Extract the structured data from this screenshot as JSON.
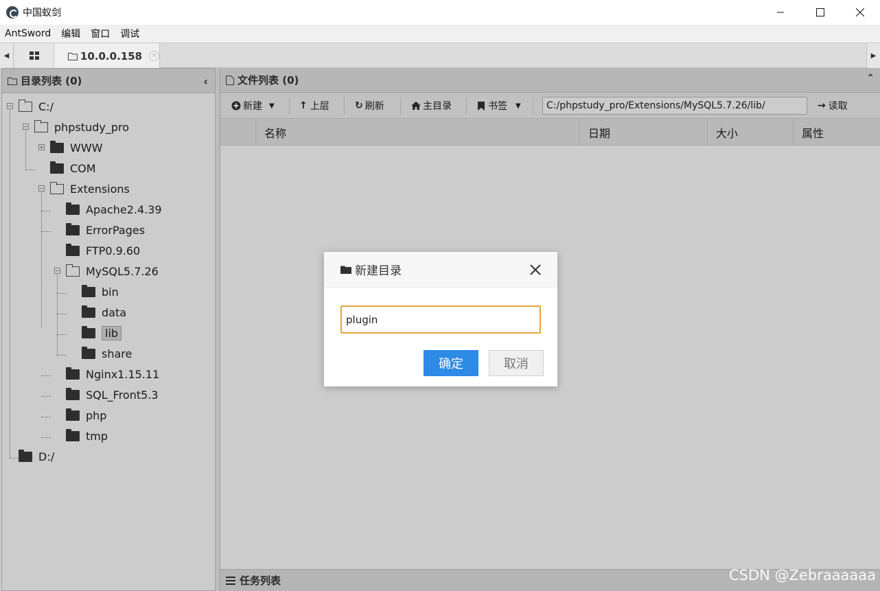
{
  "window": {
    "title": "中国蚁剑",
    "minimize_icon": "minimize-icon",
    "maximize_icon": "maximize-icon",
    "close_icon": "close-icon"
  },
  "menu": [
    "AntSword",
    "编辑",
    "窗口",
    "调试"
  ],
  "tabs": {
    "active_label": "10.0.0.158"
  },
  "left_panel": {
    "title": "目录列表 (0)"
  },
  "tree": [
    {
      "label": "C:/",
      "type": "open"
    },
    {
      "label": "phpstudy_pro",
      "type": "open"
    },
    {
      "label": "WWW",
      "type": "closed"
    },
    {
      "label": "COM",
      "type": "closed"
    },
    {
      "label": "Extensions",
      "type": "open"
    },
    {
      "label": "Apache2.4.39",
      "type": "closed"
    },
    {
      "label": "ErrorPages",
      "type": "closed"
    },
    {
      "label": "FTP0.9.60",
      "type": "closed"
    },
    {
      "label": "MySQL5.7.26",
      "type": "open"
    },
    {
      "label": "bin",
      "type": "closed"
    },
    {
      "label": "data",
      "type": "closed"
    },
    {
      "label": "lib",
      "type": "closed",
      "selected": true
    },
    {
      "label": "share",
      "type": "closed"
    },
    {
      "label": "Nginx1.15.11",
      "type": "closed"
    },
    {
      "label": "SQL_Front5.3",
      "type": "closed"
    },
    {
      "label": "php",
      "type": "closed"
    },
    {
      "label": "tmp",
      "type": "closed"
    },
    {
      "label": "D:/",
      "type": "closed"
    }
  ],
  "right_panel": {
    "title": "文件列表 (0)"
  },
  "toolbar": {
    "new_label": "新建",
    "up_label": "上层",
    "refresh_label": "刷新",
    "home_label": "主目录",
    "bookmark_label": "书签",
    "path_value": "C:/phpstudy_pro/Extensions/MySQL5.7.26/lib/",
    "read_label": "读取"
  },
  "grid": {
    "columns": [
      "名称",
      "日期",
      "大小",
      "属性"
    ]
  },
  "tasks": {
    "title": "任务列表"
  },
  "dialog": {
    "title": "新建目录",
    "input_value": "plugin",
    "ok_label": "确定",
    "cancel_label": "取消"
  },
  "watermark": "CSDN @Zebraaaaaa",
  "colors": {
    "primary": "#2d8ae6",
    "input_focus": "#e8a23e",
    "overlay": "rgba(0,0,0,0.2)"
  }
}
